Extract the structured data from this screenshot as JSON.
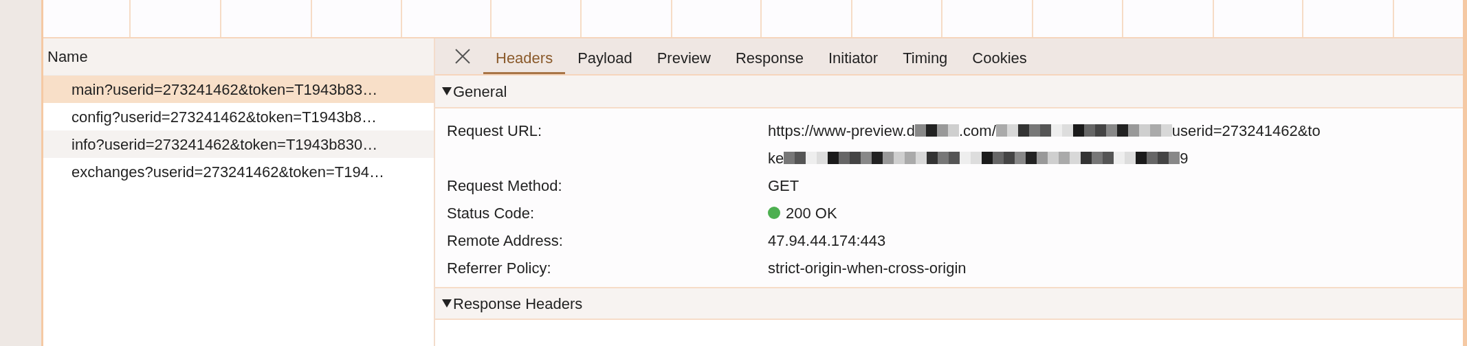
{
  "requests": {
    "header": "Name",
    "items": [
      {
        "name": "main?userid=273241462&token=T1943b83…",
        "selected": true
      },
      {
        "name": "config?userid=273241462&token=T1943b8…",
        "selected": false
      },
      {
        "name": "info?userid=273241462&token=T1943b830…",
        "selected": false
      },
      {
        "name": "exchanges?userid=273241462&token=T194…",
        "selected": false
      }
    ]
  },
  "tabs": [
    {
      "label": "Headers",
      "selected": true
    },
    {
      "label": "Payload",
      "selected": false
    },
    {
      "label": "Preview",
      "selected": false
    },
    {
      "label": "Response",
      "selected": false
    },
    {
      "label": "Initiator",
      "selected": false
    },
    {
      "label": "Timing",
      "selected": false
    },
    {
      "label": "Cookies",
      "selected": false
    }
  ],
  "sections": [
    {
      "title": "General",
      "expanded": true,
      "rows": [
        {
          "label": "Request URL:",
          "kind": "url",
          "lines": [
            [
              {
                "kind": "text",
                "text": "https://www-preview.d"
              },
              {
                "kind": "redacted"
              },
              {
                "kind": "text",
                "text": ".com/"
              },
              {
                "kind": "redacted"
              },
              {
                "kind": "text",
                "text": "userid=273241462&to"
              }
            ],
            [
              {
                "kind": "text",
                "text": "ke"
              },
              {
                "kind": "redacted"
              },
              {
                "kind": "text",
                "text": "9"
              }
            ]
          ]
        },
        {
          "label": "Request Method:",
          "kind": "text",
          "value": "GET"
        },
        {
          "label": "Status Code:",
          "kind": "status",
          "value": "200 OK",
          "color": "#4caf50"
        },
        {
          "label": "Remote Address:",
          "kind": "text",
          "value": "47.94.44.174:443"
        },
        {
          "label": "Referrer Policy:",
          "kind": "text",
          "value": "strict-origin-when-cross-origin"
        }
      ]
    },
    {
      "title": "Response Headers",
      "expanded": true
    }
  ]
}
